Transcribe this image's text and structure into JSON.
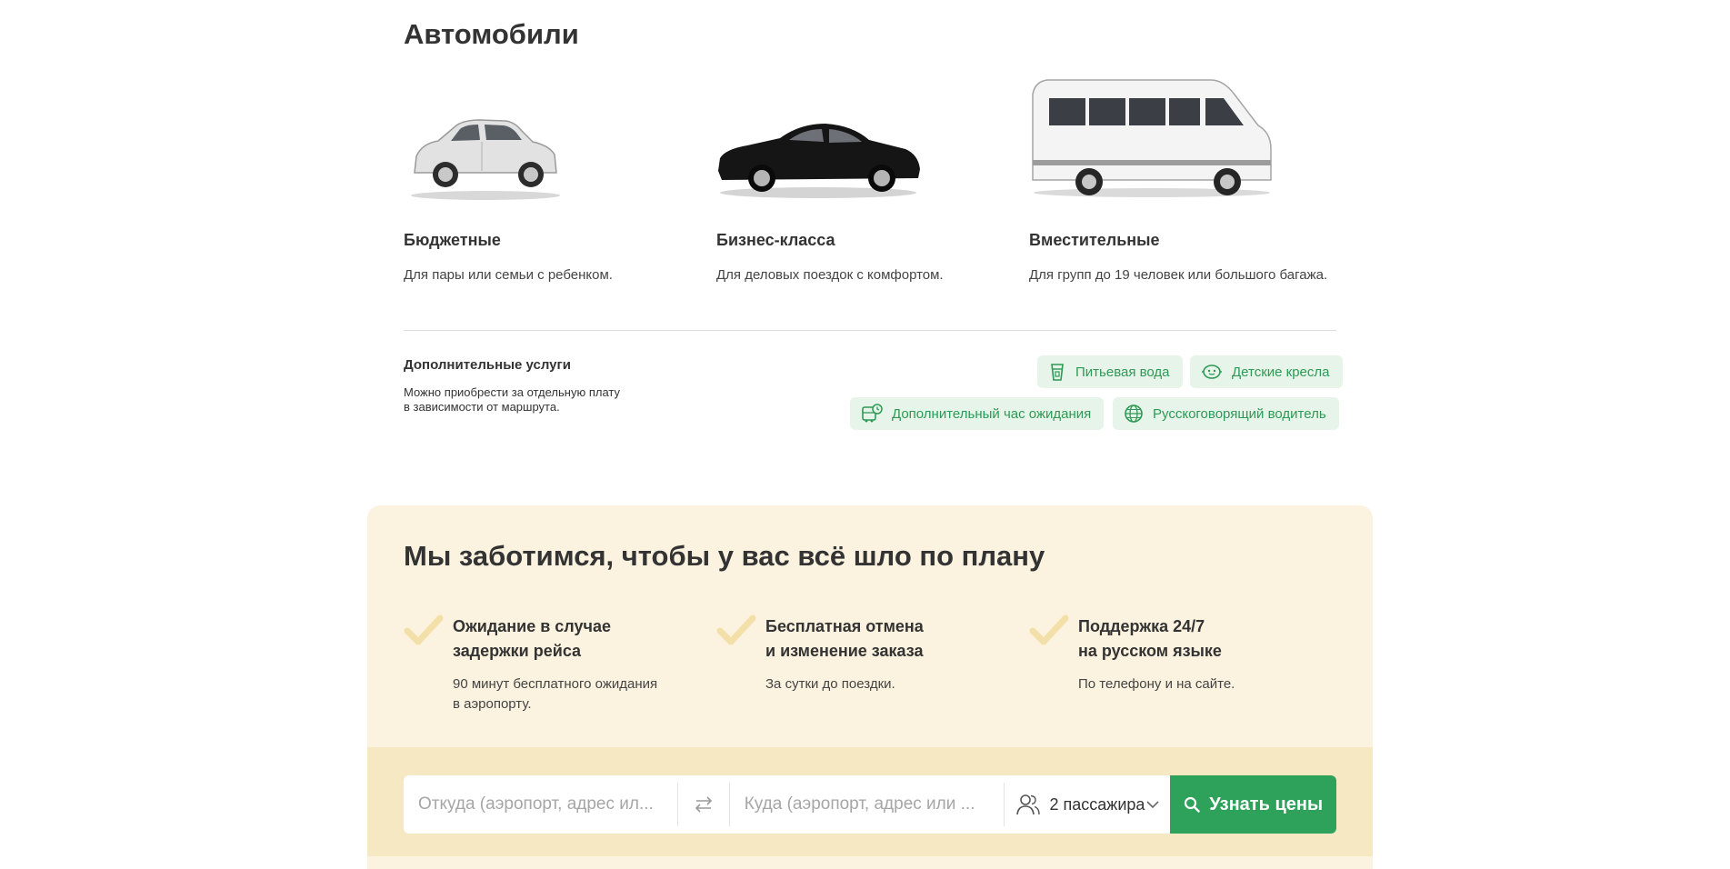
{
  "cars_section": {
    "title": "Автомобили",
    "items": [
      {
        "name": "Бюджетные",
        "desc": "Для пары или семьи с ребенком."
      },
      {
        "name": "Бизнес-класса",
        "desc": "Для деловых поездок с комфортом."
      },
      {
        "name": "Вместительные",
        "desc": "Для групп до 19 человек или большого багажа."
      }
    ]
  },
  "extras": {
    "title": "Дополнительные услуги",
    "desc_line1": "Можно приобрести за отдельную плату",
    "desc_line2": "в зависимости от маршрута.",
    "chips": [
      {
        "label": "Питьевая вода",
        "icon": "water-cup-icon"
      },
      {
        "label": "Детские кресла",
        "icon": "child-seat-icon"
      },
      {
        "label": "Дополнительный час ожидания",
        "icon": "waiting-bus-icon"
      },
      {
        "label": "Русскоговорящий водитель",
        "icon": "globe-icon"
      }
    ]
  },
  "care": {
    "title": "Мы заботимся, чтобы у вас всё шло по плану",
    "features": [
      {
        "title_line1": "Ожидание в случае",
        "title_line2": "задержки рейса",
        "desc_line1": "90 минут бесплатного ожидания",
        "desc_line2": "в аэропорту."
      },
      {
        "title_line1": "Бесплатная отмена",
        "title_line2": "и изменение заказа",
        "desc_line1": "За сутки до поездки.",
        "desc_line2": ""
      },
      {
        "title_line1": "Поддержка 24/7",
        "title_line2": "на русском языке",
        "desc_line1": "По телефону и на сайте.",
        "desc_line2": ""
      }
    ]
  },
  "search": {
    "from_placeholder": "Откуда (аэропорт, адрес ил...",
    "to_placeholder": "Куда (аэропорт, адрес или ...",
    "passengers": "2 пассажира",
    "button_label": "Узнать цены"
  },
  "colors": {
    "accent_green": "#2ea25a",
    "chip_bg": "#e6f4ea",
    "care_bg": "#fbf3df",
    "check": "#f3dfa8"
  }
}
